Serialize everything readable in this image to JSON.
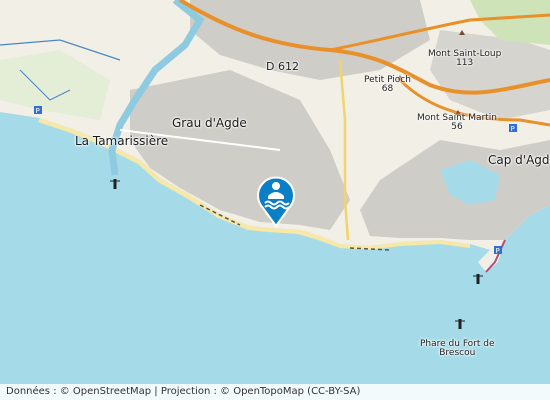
{
  "map": {
    "labels": {
      "grau_dagde": "Grau d'Agde",
      "la_tamarissiere": "La Tamarissière",
      "cap_dagde": "Cap d'Agde",
      "road_d612": "D 612",
      "petit_pioch": "Petit Pioch",
      "petit_pioch_elev": "68",
      "mont_saint_loup": "Mont Saint-Loup",
      "mont_saint_loup_elev": "113",
      "mont_saint_martin": "Mont Saint Martin",
      "mont_saint_martin_elev": "56",
      "phare_line1": "Phare du Fort de",
      "phare_line2": "Brescou"
    },
    "marker": {
      "icon": "swimmer-icon",
      "color": "#0a7fc6"
    },
    "colors": {
      "sea": "#a5dbe8",
      "land": "#f1efe6",
      "urban": "#d2d0cb",
      "highway": "#e8902a",
      "beach": "#f7e8a8"
    }
  },
  "attribution": {
    "text": "Données : © OpenStreetMap | Projection : © OpenTopoMap (CC-BY-SA)"
  }
}
